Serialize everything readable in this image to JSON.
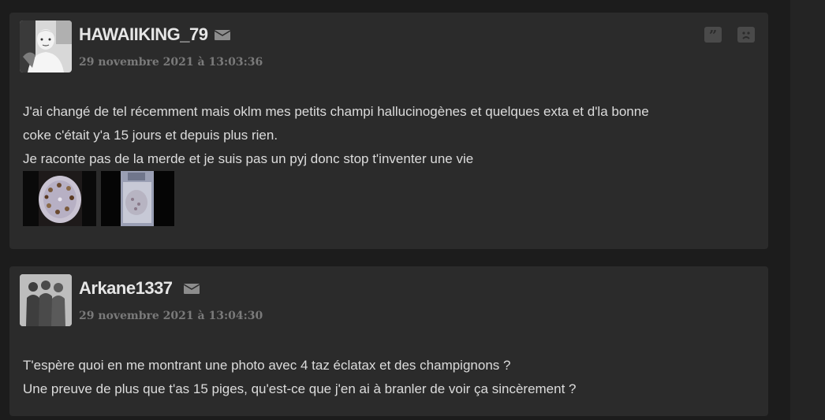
{
  "posts": [
    {
      "username": "HAWAIIKING_79",
      "date": "29 novembre 2021 à 13:03:36",
      "body_lines": [
        "J'ai changé de tel récemment mais oklm mes petits champi hallucinogènes et quelques exta et d'la bonne",
        "coke c'était y'a 15 jours et depuis plus rien.",
        "Je raconte pas de la merde et je suis pas un pyj donc stop t'inventer une vie"
      ],
      "icons": {
        "mail": "mail-icon",
        "quote": "quote-icon",
        "report": "sad-face-icon"
      },
      "quote_glyph": "”"
    },
    {
      "username": "Arkane1337",
      "date": "29 novembre 2021 à 13:04:30",
      "body_lines": [
        "T'espère quoi en me montrant une photo avec 4 taz éclatax et des champignons ?",
        "Une preuve de plus que t'as 15 piges, qu'est-ce que j'en ai à branler de voir ça sincèrement ?"
      ],
      "icons": {
        "mail": "mail-icon"
      }
    }
  ],
  "colors": {
    "page_background": "#1c1c1c",
    "post_background": "#2b2b2b",
    "username": "#e6e6e6",
    "date": "#7a7a7a",
    "body_text": "#dcdcdc"
  }
}
